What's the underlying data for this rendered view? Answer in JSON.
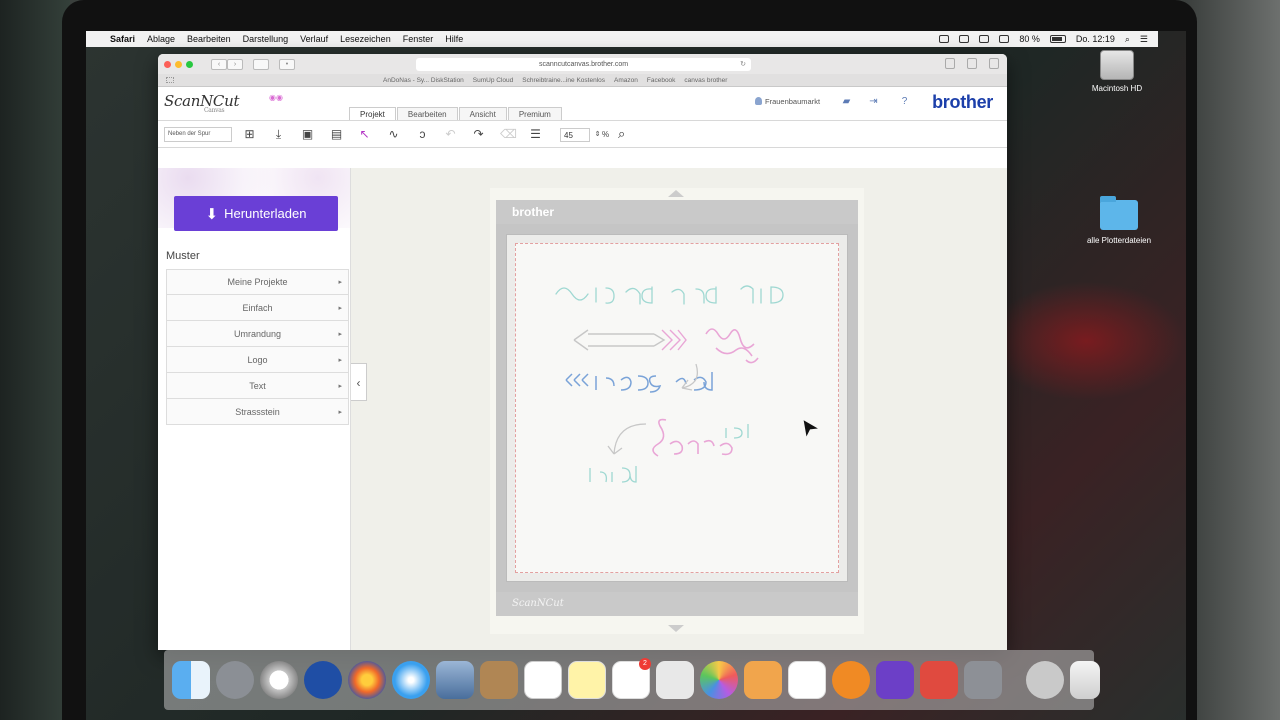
{
  "menubar": {
    "app": "Safari",
    "items": [
      "Ablage",
      "Bearbeiten",
      "Darstellung",
      "Verlauf",
      "Lesezeichen",
      "Fenster",
      "Hilfe"
    ],
    "battery": "80 %",
    "clock": "Do. 12:19"
  },
  "desktop": {
    "hd_label": "Macintosh HD",
    "folder_label": "alle Plotterdateien"
  },
  "browser": {
    "url": "scanncutcanvas.brother.com",
    "favorites": [
      "AnDoNas - Sy... DiskStation",
      "SumUp Cloud",
      "Schreibtraine...ine Kostenlos",
      "Amazon",
      "Facebook",
      "canvas brother"
    ]
  },
  "app": {
    "logo": "ScanNCut",
    "logo_sub": "Canvas",
    "user": "Frauenbaumarkt",
    "brand": "brother",
    "tabs": [
      "Projekt",
      "Bearbeiten",
      "Ansicht",
      "Premium"
    ],
    "active_tab": "Projekt",
    "select_value": "Neben der Spur",
    "zoom_value": "45",
    "zoom_unit": "%"
  },
  "sidebar": {
    "download_label": "Herunterladen",
    "section_title": "Muster",
    "items": [
      {
        "label": "Meine Projekte"
      },
      {
        "label": "Einfach"
      },
      {
        "label": "Umrandung"
      },
      {
        "label": "Logo"
      },
      {
        "label": "Text"
      },
      {
        "label": "Strassstein"
      }
    ]
  },
  "mat": {
    "header": "brother",
    "footer": "ScanNCut"
  },
  "colors": {
    "accent": "#6a3fd6",
    "brand": "#1c3faa",
    "design_teal": "#9fd8d2",
    "design_pink": "#e9a6d6",
    "design_blue": "#7aa3d8"
  }
}
